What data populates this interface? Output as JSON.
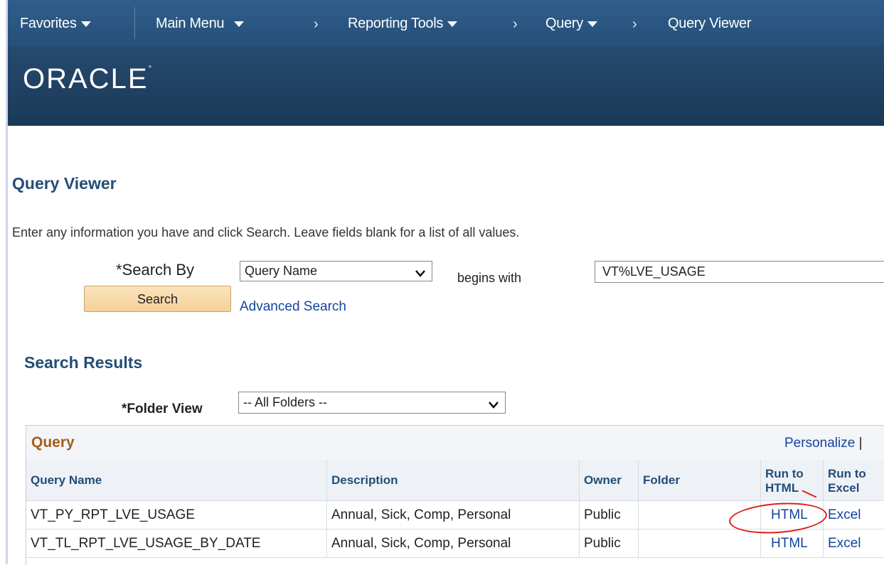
{
  "nav": {
    "favorites": "Favorites",
    "main_menu": "Main Menu",
    "reporting_tools": "Reporting Tools",
    "query": "Query",
    "query_viewer": "Query Viewer"
  },
  "brand": {
    "logo": "ORACLE",
    "logo_mark": "°"
  },
  "page": {
    "title": "Query Viewer",
    "instructions": "Enter any information you have and click Search. Leave fields blank for a list of all values."
  },
  "search": {
    "by_label": "*Search By",
    "by_value": "Query Name",
    "operator": "begins with",
    "value": "VT%LVE_USAGE",
    "button": "Search",
    "advanced": "Advanced Search"
  },
  "results": {
    "title": "Search Results",
    "folder_label": "*Folder View",
    "folder_value": "-- All Folders --",
    "grid_title": "Query",
    "personalize": "Personalize",
    "personalize_sep": "|",
    "columns": {
      "name": "Query Name",
      "description": "Description",
      "owner": "Owner",
      "folder": "Folder",
      "run_html_1": "Run to",
      "run_html_2": "HTML",
      "run_excel_1": "Run to",
      "run_excel_2": "Excel"
    },
    "rows": [
      {
        "name": "VT_PY_RPT_LVE_USAGE",
        "description": "Annual, Sick, Comp, Personal",
        "owner": "Public",
        "folder": "",
        "html": "HTML",
        "excel": "Excel"
      },
      {
        "name": "VT_TL_RPT_LVE_USAGE_BY_DATE",
        "description": "Annual, Sick, Comp, Personal",
        "owner": "Public",
        "folder": "",
        "html": "HTML",
        "excel": "Excel"
      }
    ]
  },
  "icons": {
    "dropdown": "chevron-down-icon",
    "breadcrumb": "chevron-right-icon",
    "menu_caret": "caret-down-icon"
  },
  "colors": {
    "nav": "#2d5a86",
    "brand_band": "#1d3f60",
    "heading": "#234d78",
    "link": "#14449b",
    "grid_title": "#a35d1a",
    "annotation": "#e01a1a"
  }
}
